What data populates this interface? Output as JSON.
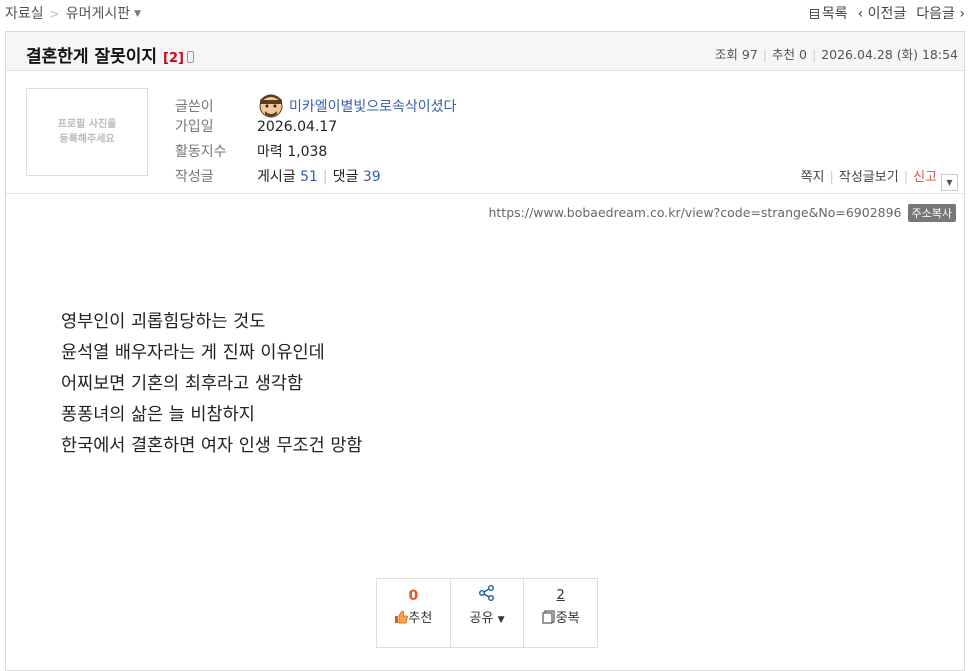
{
  "breadcrumb": {
    "root": "자료실",
    "separator": ">",
    "board": "유머게시판"
  },
  "topnav": {
    "list": "목록",
    "prev": "‹ 이전글",
    "next": "다음글 ›"
  },
  "post": {
    "title": "결혼한게 잘못이지",
    "comment_count": "[2]",
    "views_label": "조회",
    "views": "97",
    "recommend_label": "추천",
    "recommend": "0",
    "datetime": "2026.04.28 (화) 18:54"
  },
  "author": {
    "photo_placeholder_line1": "프로필 사진을",
    "photo_placeholder_line2": "등록해주세요",
    "writer_label": "글쓴이",
    "nickname": "미카엘이별빛으로속삭이셨다",
    "joined_label": "가입일",
    "joined": "2026.04.17",
    "activity_label": "활동지수",
    "activity": "마력 1,038",
    "posts_label": "작성글",
    "posts_text": "게시글",
    "posts_count": "51",
    "comments_text": "댓글",
    "comments_count": "39"
  },
  "actions": {
    "message": "쪽지",
    "view_posts": "작성글보기",
    "report": "신고"
  },
  "url": {
    "text": "https://www.bobaedream.co.kr/view?code=strange&No=6902896",
    "copy_label": "주소복사"
  },
  "content": [
    "영부인이 괴롭힘당하는 것도",
    "윤석열 배우자라는 게 진짜 이유인데",
    "어찌보면 기혼의 최후라고 생각함",
    "퐁퐁녀의 삶은 늘 비참하지",
    "한국에서 결혼하면 여자 인생 무조건 망함"
  ],
  "vote": {
    "recommend_count": "0",
    "recommend_label": "추천",
    "share_label": "공유",
    "duplicate_count": "2",
    "duplicate_label": "중복"
  },
  "icons": [
    "list-icon",
    "mobile-icon",
    "avatar-icon",
    "dropdown-icon",
    "thumbs-up-icon",
    "share-icon",
    "duplicate-icon"
  ],
  "colors": {
    "accent_red": "#d0021b",
    "link_blue": "#2b5fb5",
    "nick_blue": "#3a5ea8",
    "recommend_orange": "#e8541c"
  }
}
